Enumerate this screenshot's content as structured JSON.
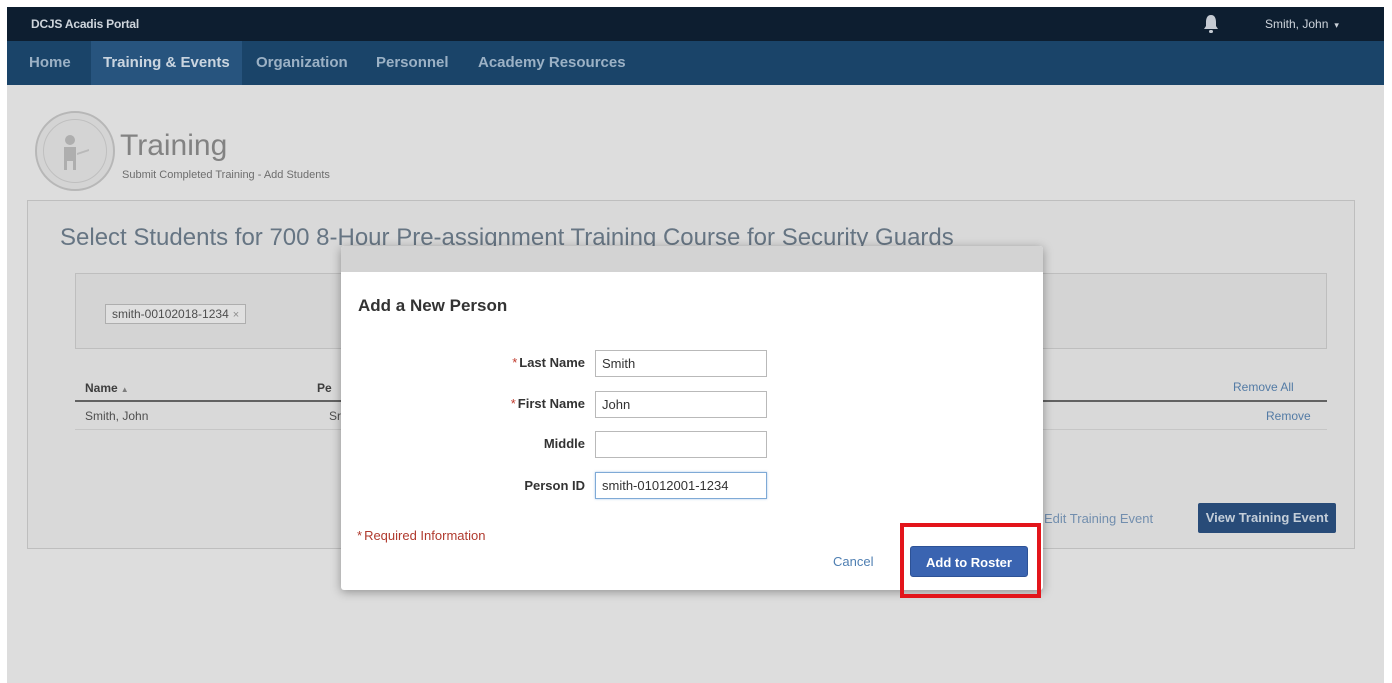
{
  "app": {
    "title": "DCJS Acadis Portal"
  },
  "user_menu": {
    "label": "Smith, John",
    "caret": "▾"
  },
  "nav": {
    "items": [
      {
        "label": "Home"
      },
      {
        "label": "Training & Events"
      },
      {
        "label": "Organization"
      },
      {
        "label": "Personnel"
      },
      {
        "label": "Academy Resources"
      }
    ]
  },
  "page": {
    "title": "Training",
    "subtitle": "Submit Completed Training - Add Students"
  },
  "panel": {
    "heading": "Select Students for 700 8-Hour Pre-assignment Training Course for Security Guards",
    "token": {
      "label": "smith-00102018-1234",
      "remove": "×"
    },
    "table": {
      "headers": {
        "name": "Name",
        "sort_arrow": "▲",
        "second_col": "Pe"
      },
      "remove_all": "Remove All",
      "rows": [
        {
          "name": "Smith, John",
          "second_col": "Sr",
          "action": "Remove"
        }
      ]
    },
    "edit_event": "Edit Training Event",
    "view_event": "View Training Event"
  },
  "modal": {
    "title": "Add a New Person",
    "required_marker": "*",
    "fields": {
      "last_name": {
        "label": "Last Name",
        "value": "Smith"
      },
      "first_name": {
        "label": "First Name",
        "value": "John"
      },
      "middle": {
        "label": "Middle",
        "value": ""
      },
      "person_id": {
        "label": "Person ID",
        "value": "smith-01012001-1234"
      }
    },
    "required_info": "Required Information",
    "cancel": "Cancel",
    "add_to_roster": "Add to Roster"
  },
  "colors": {
    "topbar": "#0f2135",
    "navbar": "#1d4a72",
    "primary_button": "#3a64b1",
    "highlight": "#e3151b"
  }
}
